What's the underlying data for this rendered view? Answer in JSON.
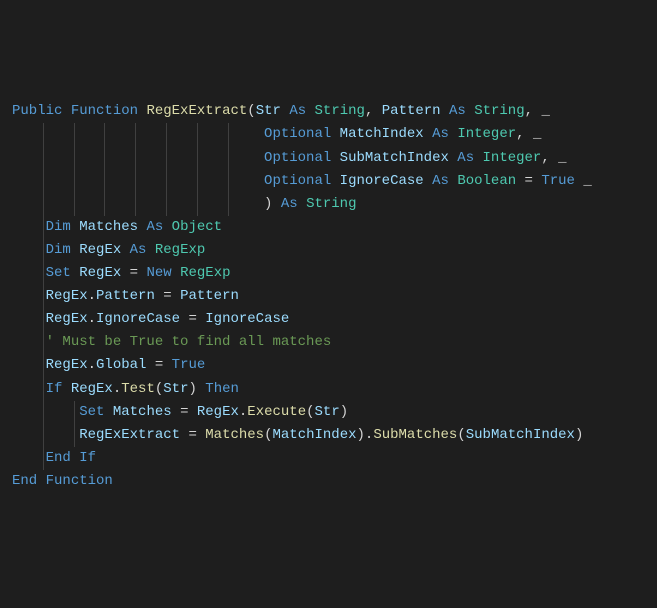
{
  "kw": {
    "public": "Public",
    "function": "Function",
    "as": "As",
    "optional": "Optional",
    "dim": "Dim",
    "set": "Set",
    "new": "New",
    "if": "If",
    "then": "Then",
    "end": "End",
    "endif": "End",
    "iftok": "If",
    "funtok": "Function"
  },
  "types": {
    "string": "String",
    "integer": "Integer",
    "boolean": "Boolean",
    "object": "Object",
    "regexp": "RegExp"
  },
  "fn": {
    "name": "RegExExtract",
    "test": "Test",
    "execute": "Execute"
  },
  "params": {
    "str": "Str",
    "pattern": "Pattern",
    "matchIndex": "MatchIndex",
    "subMatchIndex": "SubMatchIndex",
    "ignoreCase": "IgnoreCase"
  },
  "vars": {
    "matches": "Matches",
    "regex": "RegEx"
  },
  "props": {
    "pattern": "Pattern",
    "ignoreCase": "IgnoreCase",
    "global": "Global",
    "subMatches": "SubMatches"
  },
  "lits": {
    "true": "True"
  },
  "comment": "' Must be True to find all matches",
  "punct": {
    "lparen": "(",
    "rparen": ")",
    "comma": ",",
    "dot": ".",
    "eq": "=",
    "cont": "_"
  }
}
